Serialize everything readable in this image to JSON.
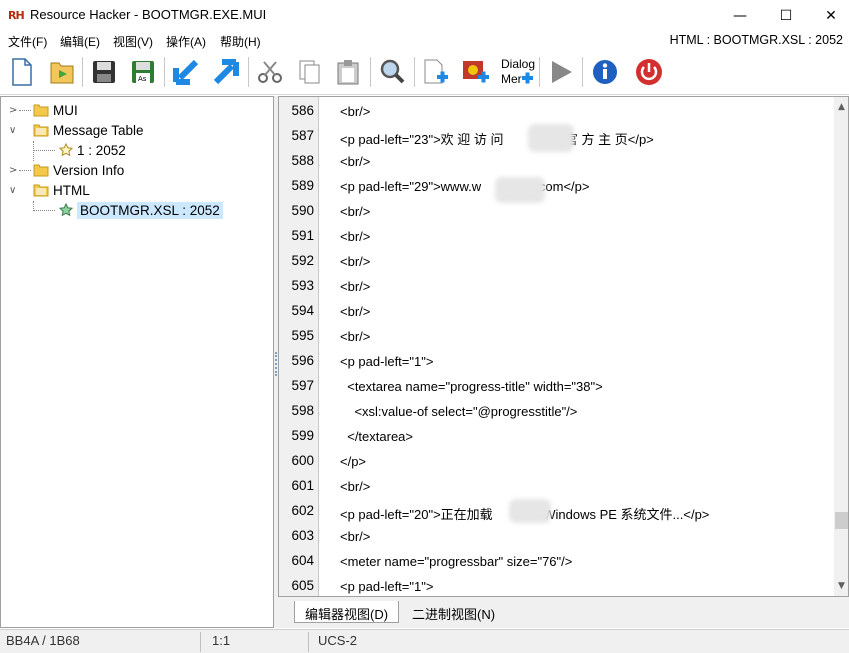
{
  "window": {
    "logo_text": "RH",
    "title": "Resource Hacker - BOOTMGR.EXE.MUI",
    "controls": [
      "—",
      "☐",
      "✕"
    ]
  },
  "menu": {
    "items": [
      "文件(F)",
      "编辑(E)",
      "视图(V)",
      "操作(A)",
      "帮助(H)"
    ],
    "current_resource": "HTML : BOOTMGR.XSL : 2052"
  },
  "toolbar": {
    "dialog_menu_label": "Dialog\nMer"
  },
  "tree": {
    "nodes": [
      {
        "label": "MUI"
      },
      {
        "label": "Message Table"
      },
      {
        "label": "1 : 2052"
      },
      {
        "label": "Version Info"
      },
      {
        "label": "HTML"
      },
      {
        "label": "BOOTMGR.XSL : 2052"
      }
    ]
  },
  "editor": {
    "line_numbers": [
      "586",
      "587",
      "588",
      "589",
      "590",
      "591",
      "592",
      "593",
      "594",
      "595",
      "596",
      "597",
      "598",
      "599",
      "600",
      "601",
      "602",
      "603",
      "604",
      "605"
    ],
    "lines": [
      "<br/>",
      "<p pad-left=\"23\">欢 迎 访 问                 官 方 主 页</p>",
      "<br/>",
      "<p pad-left=\"29\">www.w               .com</p>",
      "<br/>",
      "<br/>",
      "<br/>",
      "<br/>",
      "<br/>",
      "<br/>",
      "<p pad-left=\"1\">",
      "  <textarea name=\"progress-title\" width=\"38\">",
      "    <xsl:value-of select=\"@progresstitle\"/>",
      "  </textarea>",
      "</p>",
      "<br/>",
      "<p pad-left=\"20\">正在加载              Windows PE 系统文件...</p>",
      "<br/>",
      "<meter name=\"progressbar\" size=\"76\"/>",
      "<p pad-left=\"1\">"
    ]
  },
  "tabs": {
    "editor_view": "编辑器视图(D)",
    "binary_view": "二进制视图(N)"
  },
  "status": {
    "offset": "BB4A / 1B68",
    "position": "1:1",
    "encoding": "UCS-2"
  }
}
